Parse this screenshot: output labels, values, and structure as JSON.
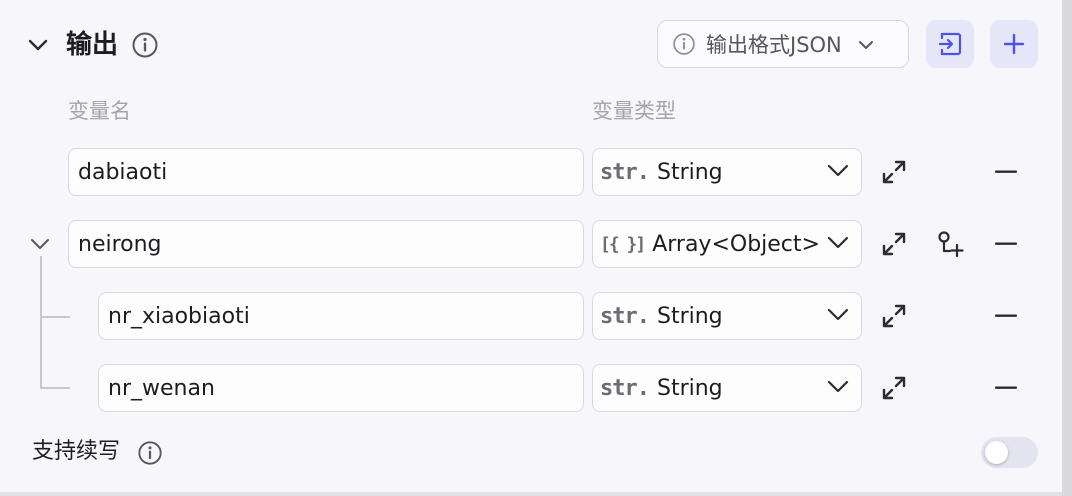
{
  "header": {
    "title": "输出",
    "output_format_label": "输出格式JSON"
  },
  "columns": {
    "name": "变量名",
    "type": "变量类型"
  },
  "rows": [
    {
      "name": "dabiaoti",
      "type_icon": "str.",
      "type_label": "String"
    },
    {
      "name": "neirong",
      "type_icon": "[{ }]",
      "type_label": "Array<Object>"
    },
    {
      "name": "nr_xiaobiaoti",
      "type_icon": "str.",
      "type_label": "String"
    },
    {
      "name": "nr_wenan",
      "type_icon": "str.",
      "type_label": "String"
    }
  ],
  "footer": {
    "continue_label": "支持续写",
    "toggle_on": false
  },
  "colors": {
    "accent": "#4d53e8",
    "accent_bg": "#e5e6f8",
    "border": "#d7d8e0"
  },
  "icons": {
    "collapse": "chevron-down-icon",
    "info": "info-icon",
    "import": "import-icon",
    "add": "plus-icon",
    "expand": "expand-icon",
    "add_child": "add-child-icon",
    "remove": "minus-icon"
  }
}
